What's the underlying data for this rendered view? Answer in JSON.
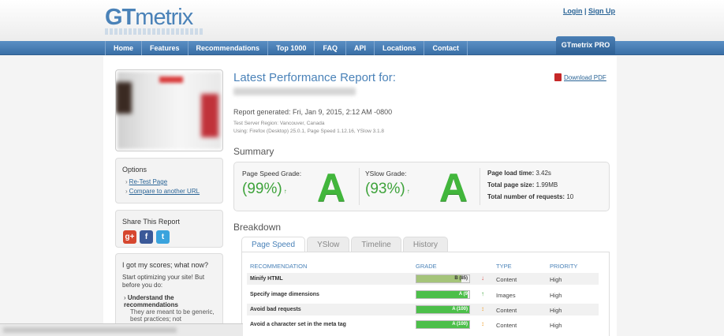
{
  "header": {
    "logo_gt": "GT",
    "logo_metrix": "metrix",
    "login": "Login",
    "signup": "Sign Up",
    "separator": "|",
    "pro": "GTmetrix PRO"
  },
  "nav": [
    "Home",
    "Features",
    "Recommendations",
    "Top 1000",
    "FAQ",
    "API",
    "Locations",
    "Contact"
  ],
  "sidebar": {
    "options_title": "Options",
    "retest": "Re-Test Page",
    "compare": "Compare to another URL",
    "share_title": "Share This Report",
    "social": [
      "g+",
      "f",
      "t"
    ],
    "scores_title": "I got my scores; what now?",
    "scores_text": "Start optimizing your site! But before you do:",
    "scores_item_title": "Understand the recommendations",
    "scores_item_text": "They are meant to be generic, best practices; not"
  },
  "report": {
    "title": "Latest Performance Report for:",
    "generated": "Report generated: Fri, Jan 9, 2015, 2:12 AM -0800",
    "server_region": "Test Server Region: Vancouver, Canada",
    "using": "Using: Firefox (Desktop) 25.0.1, Page Speed 1.12.16, YSlow 3.1.8",
    "download": "Download PDF"
  },
  "summary": {
    "heading": "Summary",
    "pagespeed_label": "Page Speed Grade:",
    "pagespeed_pct": "(99%)",
    "pagespeed_grade": "A",
    "yslow_label": "YSlow Grade:",
    "yslow_pct": "(93%)",
    "yslow_grade": "A",
    "trend_arrow": "↑",
    "load_time_label": "Page load time:",
    "load_time": "3.42s",
    "page_size_label": "Total page size:",
    "page_size": "1.99MB",
    "requests_label": "Total number of requests:",
    "requests": "10"
  },
  "breakdown": {
    "heading": "Breakdown",
    "tabs": [
      "Page Speed",
      "YSlow",
      "Timeline",
      "History"
    ],
    "columns": [
      "RECOMMENDATION",
      "GRADE",
      "TYPE",
      "PRIORITY"
    ],
    "rows": [
      {
        "name": "Minify HTML",
        "grade": "B (85)",
        "score": 85,
        "arrow": "↓",
        "arrow_color": "#d9534f",
        "type": "Content",
        "priority": "High",
        "color": "#a5c47a"
      },
      {
        "name": "Specify image dimensions",
        "grade": "A (9",
        "score": 97,
        "arrow": "↑",
        "arrow_color": "#3ea33b",
        "type": "Images",
        "priority": "High",
        "color": "#4cbf4a"
      },
      {
        "name": "Avoid bad requests",
        "grade": "A (100)",
        "score": 100,
        "arrow": "↕",
        "arrow_color": "#f0a030",
        "type": "Content",
        "priority": "High",
        "color": "#4cbf4a"
      },
      {
        "name": "Avoid a character set in the meta tag",
        "grade": "A (100)",
        "score": 100,
        "arrow": "↕",
        "arrow_color": "#f0a030",
        "type": "Content",
        "priority": "High",
        "color": "#4cbf4a"
      }
    ]
  }
}
